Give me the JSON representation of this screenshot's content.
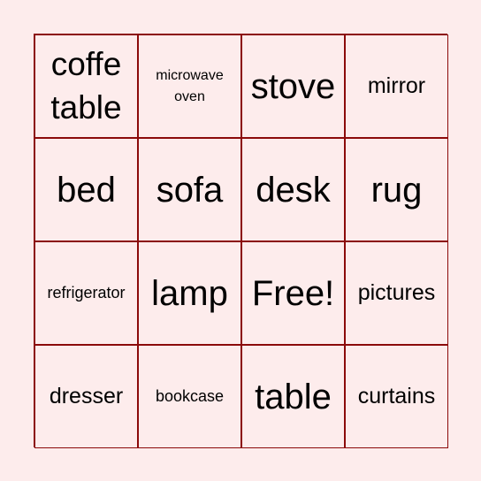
{
  "board": {
    "border_color": "#8b0a0a",
    "background_color": "#fdecec",
    "cells": [
      {
        "text": "coffe table",
        "size": "s-l"
      },
      {
        "text": "microwave oven",
        "size": "s-xs"
      },
      {
        "text": "stove",
        "size": "s-xl"
      },
      {
        "text": "mirror",
        "size": "s-m"
      },
      {
        "text": "bed",
        "size": "s-xl"
      },
      {
        "text": "sofa",
        "size": "s-xl"
      },
      {
        "text": "desk",
        "size": "s-xl"
      },
      {
        "text": "rug",
        "size": "s-xl"
      },
      {
        "text": "refrigerator",
        "size": "s-s"
      },
      {
        "text": "lamp",
        "size": "s-xl"
      },
      {
        "text": "Free!",
        "size": "s-xl"
      },
      {
        "text": "pictures",
        "size": "s-m"
      },
      {
        "text": "dresser",
        "size": "s-m"
      },
      {
        "text": "bookcase",
        "size": "s-s"
      },
      {
        "text": "table",
        "size": "s-xl"
      },
      {
        "text": "curtains",
        "size": "s-m"
      }
    ]
  }
}
